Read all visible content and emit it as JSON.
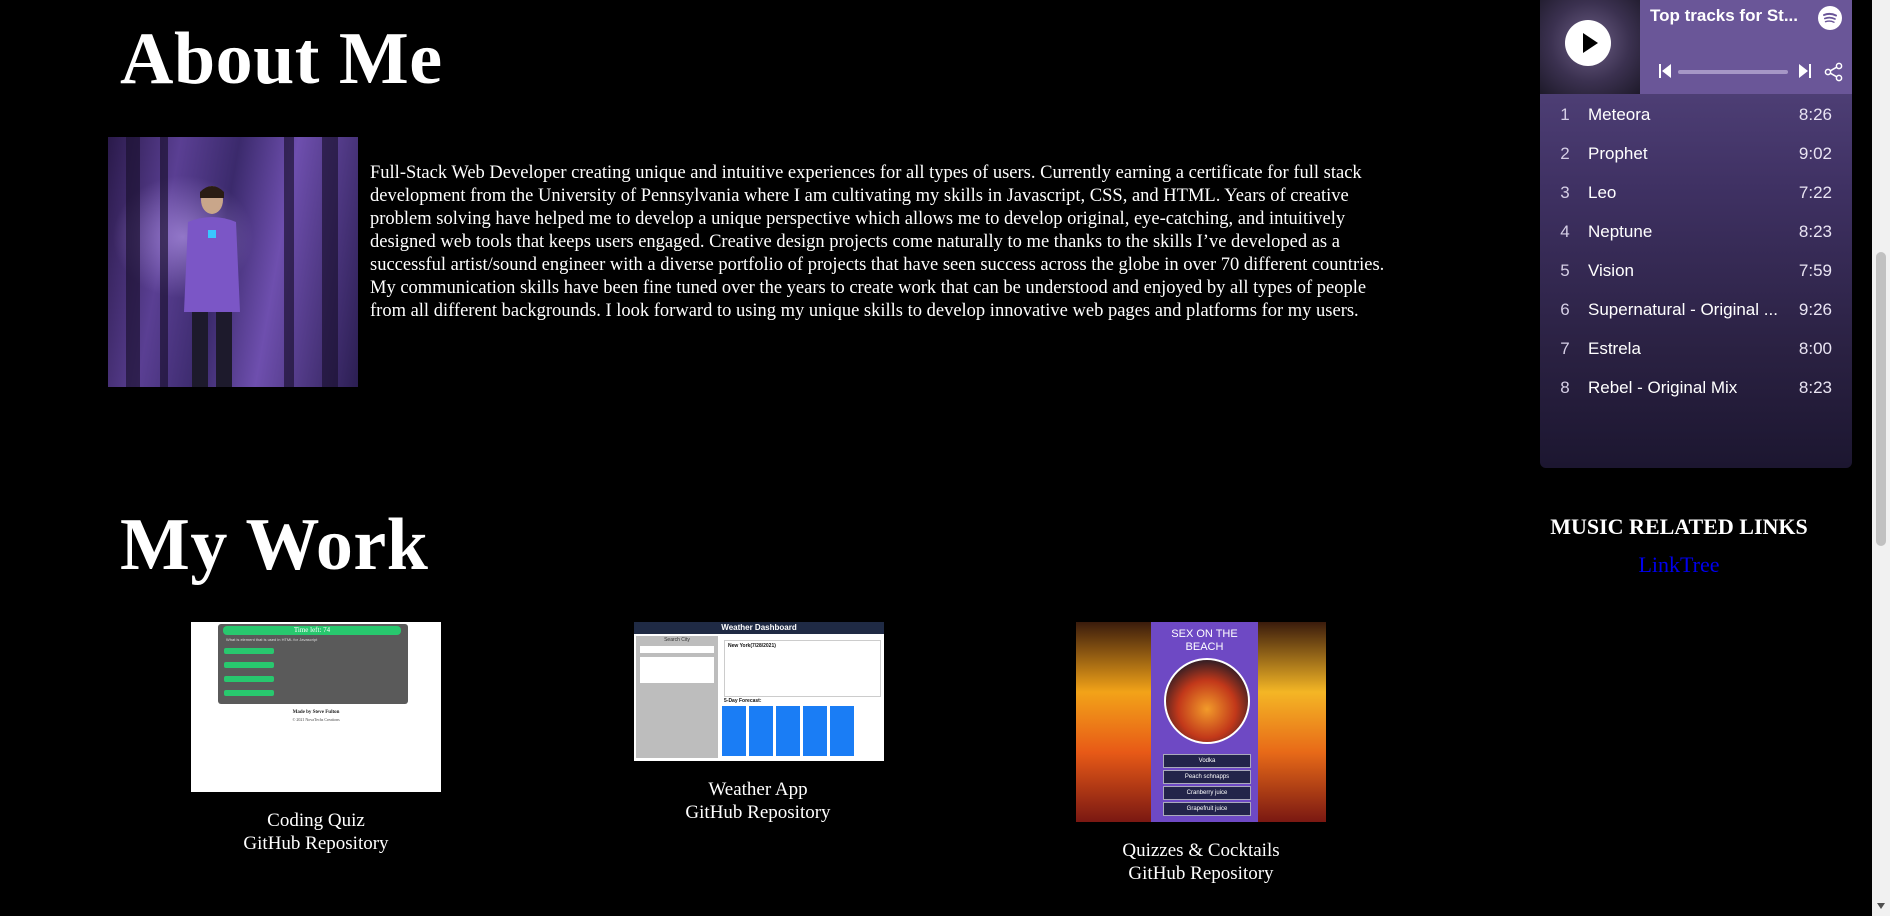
{
  "about": {
    "title": "About Me",
    "bio": "Full-Stack Web Developer creating unique and intuitive experiences for all types of users. Currently earning a certificate for full stack development from the University of Pennsylvania where I am cultivating my skills in Javascript, CSS, and HTML. Years of creative problem solving have helped me to develop a unique perspective which allows me to develop original, eye-catching, and intuitively designed web tools that keeps users engaged. Creative design projects come naturally to me thanks to the skills I’ve developed as a successful artist/sound engineer with a diverse portfolio of projects that have seen success across the globe in over 70 different countries. My communication skills have been fine tuned over the years to create work that can be understood and enjoyed by all types of people from all different backgrounds. I look forward to using my unique skills to develop innovative web pages and platforms for my users."
  },
  "spotify": {
    "playlist_title": "Top tracks for St...",
    "tracks": [
      {
        "num": "1",
        "title": "Meteora",
        "duration": "8:26"
      },
      {
        "num": "2",
        "title": "Prophet",
        "duration": "9:02"
      },
      {
        "num": "3",
        "title": "Leo",
        "duration": "7:22"
      },
      {
        "num": "4",
        "title": "Neptune",
        "duration": "8:23"
      },
      {
        "num": "5",
        "title": "Vision",
        "duration": "7:59"
      },
      {
        "num": "6",
        "title": "Supernatural - Original ...",
        "duration": "9:26"
      },
      {
        "num": "7",
        "title": "Estrela",
        "duration": "8:00"
      },
      {
        "num": "8",
        "title": "Rebel - Original Mix",
        "duration": "8:23"
      }
    ],
    "icons": [
      "play-icon",
      "spotify-icon",
      "previous-track-icon",
      "next-track-icon",
      "share-icon"
    ],
    "accent_color": "#6a5698"
  },
  "music_links": {
    "heading": "MUSIC RELATED LINKS",
    "link_label": "LinkTree",
    "link_color": "#0000ee"
  },
  "work": {
    "title": "My Work",
    "projects": [
      {
        "name": "Coding Quiz",
        "repo_label": "GitHub Repository",
        "thumb": {
          "timer": "Time left: 74",
          "question": "What is element that is used in HTML for Javascript",
          "footer": "Made by Steve Fulton",
          "copyright": "© 2021 NovaTechs Creations"
        }
      },
      {
        "name": "Weather App",
        "repo_label": "GitHub Repository",
        "thumb": {
          "header": "Weather Dashboard",
          "search_label": "Search City",
          "city": "New York(7/28/2021)",
          "forecast_label": "5-Day Forecast:"
        }
      },
      {
        "name": "Quizzes & Cocktails",
        "repo_label": "GitHub Repository",
        "thumb": {
          "cocktail": "SEX ON THE BEACH",
          "ingredients": [
            "Vodka",
            "Peach schnapps",
            "Cranberry juice",
            "Grapefruit juice"
          ]
        }
      }
    ]
  }
}
